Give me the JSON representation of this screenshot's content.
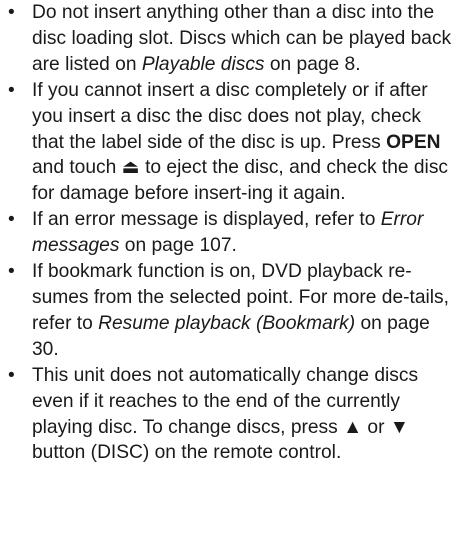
{
  "bullet_glyph": "•",
  "items": [
    {
      "t1": "Do not insert anything other than a disc into the disc loading slot. Discs which can be played back are listed on ",
      "i1": "Playable discs",
      "t2": " on page 8."
    },
    {
      "t1": "If you cannot insert a disc completely or if after you insert a disc the disc does not play, check that the label side of the disc is up. Press ",
      "b1": "OPEN",
      "t2": " and touch ",
      "sym": "⏏",
      "t3": " to eject the disc, and check the disc for damage before insert-ing it again."
    },
    {
      "t1": "If an error message is displayed, refer to ",
      "i1": "Error messages",
      "t2": " on page 107."
    },
    {
      "t1": "If bookmark function is on, DVD playback re-sumes from the selected point. For more de-tails, refer to ",
      "i1": "Resume playback (Bookmark)",
      "t2": " on page 30."
    },
    {
      "t1": "This unit does not automatically change discs even if it reaches to the end of the currently playing disc. To change discs, press ",
      "up": "▲",
      "t2": " or ",
      "down": "▼",
      "t3": " button (DISC) on the remote control."
    }
  ]
}
